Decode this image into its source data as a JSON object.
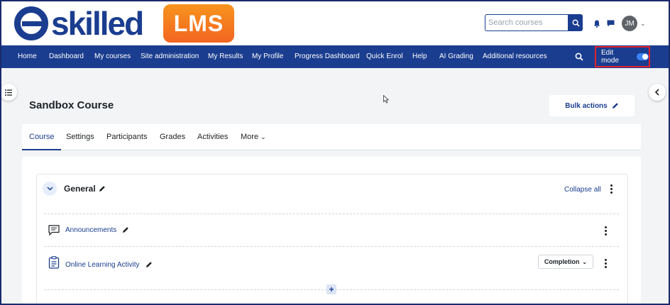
{
  "brand": {
    "name": "eskilled",
    "badge": "LMS"
  },
  "header": {
    "search_placeholder": "Search courses",
    "avatar_initials": "JM"
  },
  "nav": {
    "items": [
      "Home",
      "Dashboard",
      "My courses",
      "Site administration",
      "My Results",
      "My Profile",
      "Progress Dashboard",
      "Quick Enrol",
      "Help",
      "AI Grading",
      "Additional resources"
    ],
    "edit_mode_label": "Edit mode",
    "edit_mode_on": true
  },
  "page": {
    "title": "Sandbox Course",
    "bulk_actions": "Bulk actions"
  },
  "tabs": [
    "Course",
    "Settings",
    "Participants",
    "Grades",
    "Activities",
    "More"
  ],
  "section": {
    "title": "General",
    "collapse_all": "Collapse all",
    "activities": [
      {
        "label": "Announcements",
        "icon": "forum-icon"
      },
      {
        "label": "Online Learning Activity",
        "icon": "assignment-icon",
        "completion": "Completion"
      }
    ]
  },
  "colors": {
    "brand_blue": "#1a3d8f",
    "accent_orange": "#f26522",
    "highlight_red": "#e0202e"
  }
}
